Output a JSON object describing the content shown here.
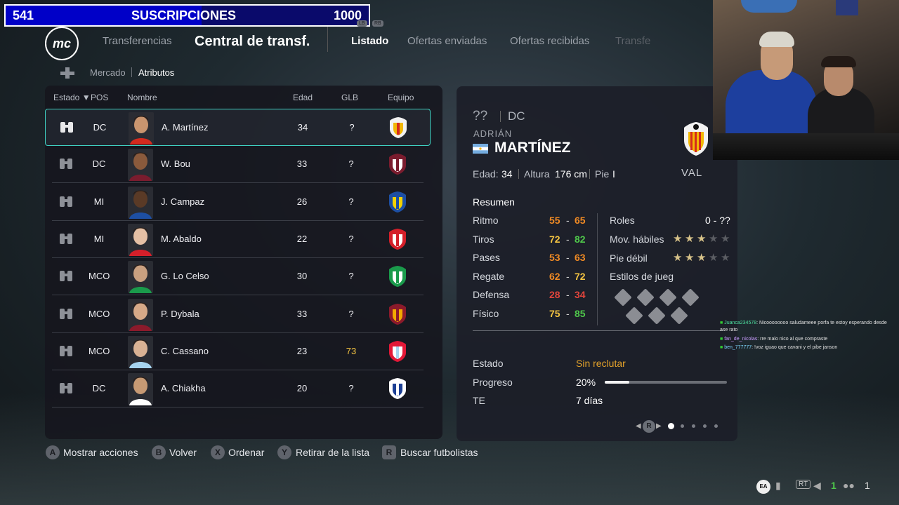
{
  "overlay": {
    "left_count": "541",
    "title": "SUSCRIPCIONES",
    "goal": "1000"
  },
  "header": {
    "logo": "mc",
    "section": "Transferencias",
    "title": "Central de transf.",
    "tabs": [
      "Listado",
      "Ofertas enviadas",
      "Ofertas recibidas",
      "Transfe"
    ],
    "shoulder_left": "LB",
    "shoulder_right": "RB"
  },
  "subnav": {
    "items": [
      "Mercado",
      "Atributos"
    ]
  },
  "table": {
    "headers": {
      "estado": "Estado",
      "pos": "POS",
      "nombre": "Nombre",
      "edad": "Edad",
      "glb": "GLB",
      "equipo": "Equipo"
    },
    "rows": [
      {
        "pos": "DC",
        "name": "A. Martínez",
        "age": "34",
        "glb": "?",
        "club": "valencia"
      },
      {
        "pos": "DC",
        "name": "W. Bou",
        "age": "33",
        "glb": "?",
        "club": "lanus"
      },
      {
        "pos": "MI",
        "name": "J. Campaz",
        "age": "26",
        "glb": "?",
        "club": "rosario-central"
      },
      {
        "pos": "MI",
        "name": "M. Abaldo",
        "age": "22",
        "glb": "?",
        "club": "independiente"
      },
      {
        "pos": "MCO",
        "name": "G. Lo Celso",
        "age": "30",
        "glb": "?",
        "club": "betis"
      },
      {
        "pos": "MCO",
        "name": "P. Dybala",
        "age": "33",
        "glb": "?",
        "club": "roma"
      },
      {
        "pos": "MCO",
        "name": "C. Cassano",
        "age": "23",
        "glb": "73",
        "club": "chicago-fire"
      },
      {
        "pos": "DC",
        "name": "A. Chiakha",
        "age": "20",
        "glb": "?",
        "club": "copenhagen"
      }
    ]
  },
  "detail": {
    "rating": "??",
    "position": "DC",
    "first_name": "ADRIÁN",
    "last_name": "MARTÍNEZ",
    "club_abbr": "VAL",
    "age_label": "Edad:",
    "age": "34",
    "height_label": "Altura",
    "height": "176 cm",
    "foot_label": "Pie",
    "foot": "I",
    "summary_title": "Resumen",
    "stats": [
      {
        "label": "Ritmo",
        "min": "55",
        "max": "65"
      },
      {
        "label": "Tiros",
        "min": "72",
        "max": "82"
      },
      {
        "label": "Pases",
        "min": "53",
        "max": "63"
      },
      {
        "label": "Regate",
        "min": "62",
        "max": "72"
      },
      {
        "label": "Defensa",
        "min": "28",
        "max": "34"
      },
      {
        "label": "Físico",
        "min": "75",
        "max": "85"
      }
    ],
    "dash": "-",
    "roles_label": "Roles",
    "roles_value": "0 - ??",
    "skill_moves_label": "Mov. hábiles",
    "skill_moves_stars": 3,
    "weak_foot_label": "Pie débil",
    "weak_foot_stars": 3,
    "playstyles_label": "Estilos de jueg",
    "status_label": "Estado",
    "status_value": "Sin reclutar",
    "progress_label": "Progreso",
    "progress_value": "20%",
    "progress_fraction": 0.2,
    "te_label": "TE",
    "te_value": "7 días",
    "pager_button": "R"
  },
  "hints": [
    {
      "key": "A",
      "label": "Mostrar acciones"
    },
    {
      "key": "B",
      "label": "Volver"
    },
    {
      "key": "X",
      "label": "Ordenar"
    },
    {
      "key": "Y",
      "label": "Retirar de la lista"
    },
    {
      "key": "R",
      "label": "Buscar futbolistas"
    }
  ],
  "chat": [
    {
      "user": "Juanca234578",
      "msg": ": Nicoooooooo saludameee porfa te estoy esperando desde",
      "cont": "ase rato"
    },
    {
      "user": "fan_de_nicolas",
      "msg": ": rre malo nico al que compraste",
      "cont": ""
    },
    {
      "user": "ben_777777",
      "msg": ": !voz iguao que cavani y el pibe janson",
      "cont": ""
    }
  ],
  "footer": {
    "ea": "EA",
    "rt": "RT",
    "count_a": "1",
    "count_b": "1"
  },
  "colors": {
    "selected_border": "#3fd1c2",
    "status_orange": "#e2a12a"
  }
}
